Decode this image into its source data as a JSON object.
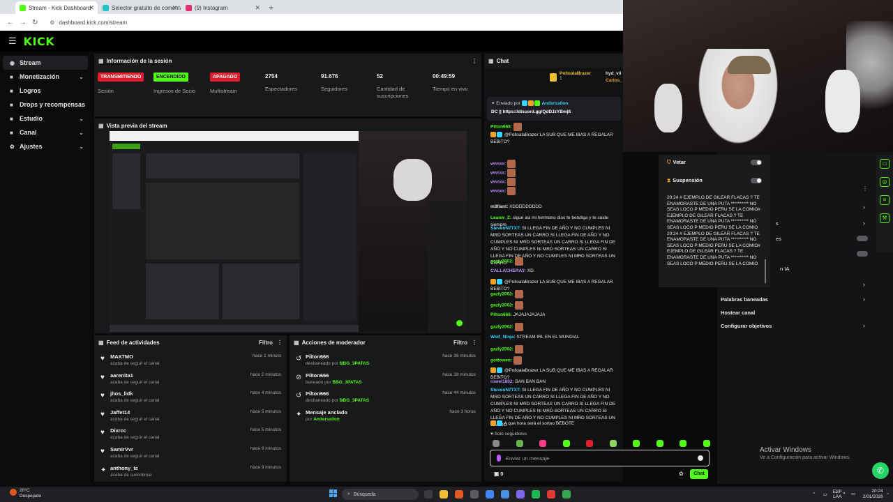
{
  "browser": {
    "tabs": [
      {
        "title": "Stream - Kick Dashboard",
        "fav": "#53fc18",
        "active": true
      },
      {
        "title": "Selector gratuito de comentarios",
        "fav": "#24c4c4",
        "active": false
      },
      {
        "title": "(9) Instagram",
        "fav": "#e1306c",
        "active": false
      }
    ],
    "new_tab": "+",
    "url": "dashboard.kick.com/stream"
  },
  "header": {
    "logo": "KICK"
  },
  "sidebar": {
    "items": [
      {
        "label": "Stream",
        "icon": "broadcast-icon",
        "glyph": "◉",
        "chev": false,
        "active": true
      },
      {
        "label": "Monetización",
        "icon": "money-icon",
        "glyph": "■",
        "chev": true,
        "active": false
      },
      {
        "label": "Logros",
        "icon": "trophy-icon",
        "glyph": "■",
        "chev": false,
        "active": false
      },
      {
        "label": "Drops y recompensas",
        "icon": "gift-icon",
        "glyph": "■",
        "chev": false,
        "active": false
      },
      {
        "label": "Estudio",
        "icon": "studio-icon",
        "glyph": "■",
        "chev": true,
        "active": false
      },
      {
        "label": "Canal",
        "icon": "channel-icon",
        "glyph": "■",
        "chev": true,
        "active": false
      },
      {
        "label": "Ajustes",
        "icon": "gear-icon",
        "glyph": "✿",
        "chev": true,
        "active": false
      }
    ]
  },
  "session": {
    "title": "Información de la sesión",
    "stats": [
      {
        "badge": "TRANSMITIENDO",
        "badge_color": "red",
        "label": "Sesión"
      },
      {
        "badge": "ENCENDIDO",
        "badge_color": "green",
        "label": "Ingresos de Socio"
      },
      {
        "badge": "APAGADO",
        "badge_color": "red",
        "label": "Multistream"
      },
      {
        "value": "2754",
        "label": "Espectadores"
      },
      {
        "value": "91.676",
        "label": "Seguidores"
      },
      {
        "value": "52",
        "label": "Cantidad de suscripciones"
      },
      {
        "value": "00:49:59",
        "label": "Tiempo en vivo"
      }
    ]
  },
  "preview": {
    "title": "Vista previa del stream"
  },
  "activity": {
    "title": "Feed de actividades",
    "filter": "Filtro",
    "items": [
      {
        "name": "MAX7MO",
        "sub": "acaba de seguir el canal",
        "time": "hace 1 minuto",
        "icon": "heart-icon",
        "glyph": "♥"
      },
      {
        "name": "aarenita1",
        "sub": "acaba de seguir el canal",
        "time": "hace 2 minutos",
        "icon": "heart-icon",
        "glyph": "♥"
      },
      {
        "name": "jhos_lidk",
        "sub": "acaba de seguir el canal",
        "time": "hace 4 minutos",
        "icon": "heart-icon",
        "glyph": "♥"
      },
      {
        "name": "Jaffet14",
        "sub": "acaba de seguir el canal",
        "time": "hace 5 minutos",
        "icon": "heart-icon",
        "glyph": "♥"
      },
      {
        "name": "Dixrcc",
        "sub": "acaba de seguir el canal",
        "time": "hace 5 minutos",
        "icon": "heart-icon",
        "glyph": "♥"
      },
      {
        "name": "SamirVvr",
        "sub": "acaba de seguir el canal",
        "time": "hace 9 minutos",
        "icon": "heart-icon",
        "glyph": "♥"
      },
      {
        "name": "anthony_tc",
        "sub": "acaba de suscribirse",
        "time": "hace 9 minutos",
        "icon": "star-icon",
        "glyph": "✦"
      }
    ]
  },
  "modactions": {
    "title": "Acciones de moderador",
    "filter": "Filtro",
    "items": [
      {
        "name": "Pilton666",
        "sub": "desbaneado por",
        "by": "BBG_3PATAS",
        "time": "hace 36 minutos",
        "icon": "undo-icon",
        "glyph": "↺"
      },
      {
        "name": "Pilton666",
        "sub": "baneado por",
        "by": "BBG_3PATAS",
        "time": "hace 38 minutos",
        "icon": "ban-icon",
        "glyph": "⊘"
      },
      {
        "name": "Pilton666",
        "sub": "desbaneado por",
        "by": "BBG_3PATAS",
        "time": "hace 44 minutos",
        "icon": "undo-icon",
        "glyph": "↺"
      },
      {
        "name": "Mensaje anclado",
        "sub": "por",
        "by": "Anderss0on",
        "time": "hace 3 horas",
        "icon": "pin-icon",
        "glyph": "✦"
      }
    ]
  },
  "chat": {
    "title": "Chat",
    "top_users": [
      {
        "name": "PolloalaBrazer",
        "count": "1"
      },
      {
        "name": "hyd_vii",
        "count": ""
      },
      {
        "name": "Carlos_",
        "count": ""
      }
    ],
    "pinned": {
      "by_label": "Enviado por",
      "by_user": "Anderss0on",
      "text": "DC || https://discord.gg/QdDJzYBmj8"
    },
    "messages": [
      {
        "user": "Pilton666:",
        "color": "#53fc18",
        "text": ""
      },
      {
        "user": "",
        "color": "#ff6a6a",
        "text": "@PolloalaBrazer LA SUB QUE ME IBAS A REGALAR BEBITO?"
      },
      {
        "user": "wnnxx:",
        "color": "#c08bff",
        "text": ""
      },
      {
        "user": "wnnxx:",
        "color": "#c08bff",
        "text": ""
      },
      {
        "user": "wnnxx:",
        "color": "#c08bff",
        "text": ""
      },
      {
        "user": "wnnxx:",
        "color": "#c08bff",
        "text": ""
      },
      {
        "user": "m3fiant:",
        "color": "#e6e6e6",
        "text": "XDDDDDDDDD"
      },
      {
        "user": "Leaow_Z:",
        "color": "#53fc18",
        "text": "sigue asi mi hermano dios te bendiga y te cuide siempre"
      },
      {
        "user": "StevenN7TXT:",
        "color": "#3ad3ff",
        "text": "SI LLEGA FIN DE AÑO Y NO CUMPLES NI MRD SORTEAS UN CARRO SI LLEGA FIN DE AÑO Y NO CUMPLES NI MRD SORTEAS UN CARRO SI LLEGA FIN DE AÑO Y NO CUMPLES NI MRD SORTEAS UN CARRO SI LLEGA FIN DE AÑO Y NO CUMPLES NI MRD SORTEAS UN CARRO"
      },
      {
        "user": "gazly2002:",
        "color": "#53fc18",
        "text": ""
      },
      {
        "user": "CALLACHERA3:",
        "color": "#c08bff",
        "text": "XD"
      },
      {
        "user": "",
        "color": "#ff6a6a",
        "text": "@PolloalaBrazer LA SUB QUE ME IBAS A REGALAR BEBITO?"
      },
      {
        "user": "gazly2002:",
        "color": "#53fc18",
        "text": ""
      },
      {
        "user": "gazly2002:",
        "color": "#53fc18",
        "text": ""
      },
      {
        "user": "Pilton666:",
        "color": "#53fc18",
        "text": "JAJAJAJAJAJA"
      },
      {
        "user": "gazly2002:",
        "color": "#53fc18",
        "text": ""
      },
      {
        "user": "Wolf_Ninja:",
        "color": "#3ad3ff",
        "text": "STREAM IRL EN EL MUNDIAL"
      },
      {
        "user": "gazly2002:",
        "color": "#53fc18",
        "text": ""
      },
      {
        "user": "gottowen:",
        "color": "#53fc18",
        "text": ""
      },
      {
        "user": "",
        "color": "#ff6a6a",
        "text": "@PolloalaBrazer LA SUB QUE ME IBAS A REGALAR BEBITO?"
      },
      {
        "user": "rowel1802:",
        "color": "#c08bff",
        "text": "BAN BAN BAN"
      },
      {
        "user": "StevenN7TXT:",
        "color": "#3ad3ff",
        "text": "SI LLEGA FIN DE AÑO Y NO CUMPLES NI MRD SORTEAS UN CARRO SI LLEGA FIN DE AÑO Y NO CUMPLES NI MRD SORTEAS UN CARRO SI LLEGA FIN DE AÑO Y NO CUMPLES NI MRD SORTEAS UN CARRO SI LLEGA FIN DE AÑO Y NO CUMPLES NI MRD SORTEAS UN CARRO"
      },
      {
        "user": "",
        "color": "#ff6a6a",
        "text": "A que hora será el sorteo BEBOTE"
      }
    ],
    "mode": "Solo seguidores",
    "input_placeholder": "Enviar un mensaje",
    "points": "0",
    "send_label": "Chat"
  },
  "modpanel": {
    "rows": [
      {
        "label": "Vetar",
        "icon": "shield-icon",
        "glyph": "⛉"
      },
      {
        "label": "Suspensión",
        "icon": "hourglass-icon",
        "glyph": "⧗"
      }
    ],
    "text": "20:24 # EJEMPLO DE GILEAR FLACAS ? TE ENAMORASTE DE UNA PUTA ********** NO SEAS LOCO P MEDIO PERU SE LA COMIO# EJEMPLO DE GILEAR FLACAS ? TE ENAMORASTE DE UNA PUTA ********** NO SEAS LOCO P MEDIO PERU SE LA COMIO\n20:24 # EJEMPLO DE GILEAR FLACAS ? TE ENAMORASTE DE UNA PUTA ********** NO SEAS LOCO P MEDIO PERU SE LA COMIO# EJEMPLO DE GILEAR FLACAS ? TE ENAMORASTE DE UNA PUTA ********** NO SEAS LOCO P MEDIO PERU SE LA COMIO"
  },
  "right_options": {
    "partial": [
      "s",
      "es",
      "n IA"
    ],
    "items": [
      "Palabras baneadas",
      "Hostear canal",
      "Configurar objetivos"
    ]
  },
  "windows": {
    "activate_title": "Activar Windows",
    "activate_sub": "Ve a Configuración para activar Windows."
  },
  "taskbar": {
    "weather_temp": "20°C",
    "weather_desc": "Despejado",
    "search_placeholder": "Búsqueda",
    "lang_top": "ESP",
    "lang_bottom": "LAA",
    "time": "20:24",
    "date": "2/01/2026"
  }
}
